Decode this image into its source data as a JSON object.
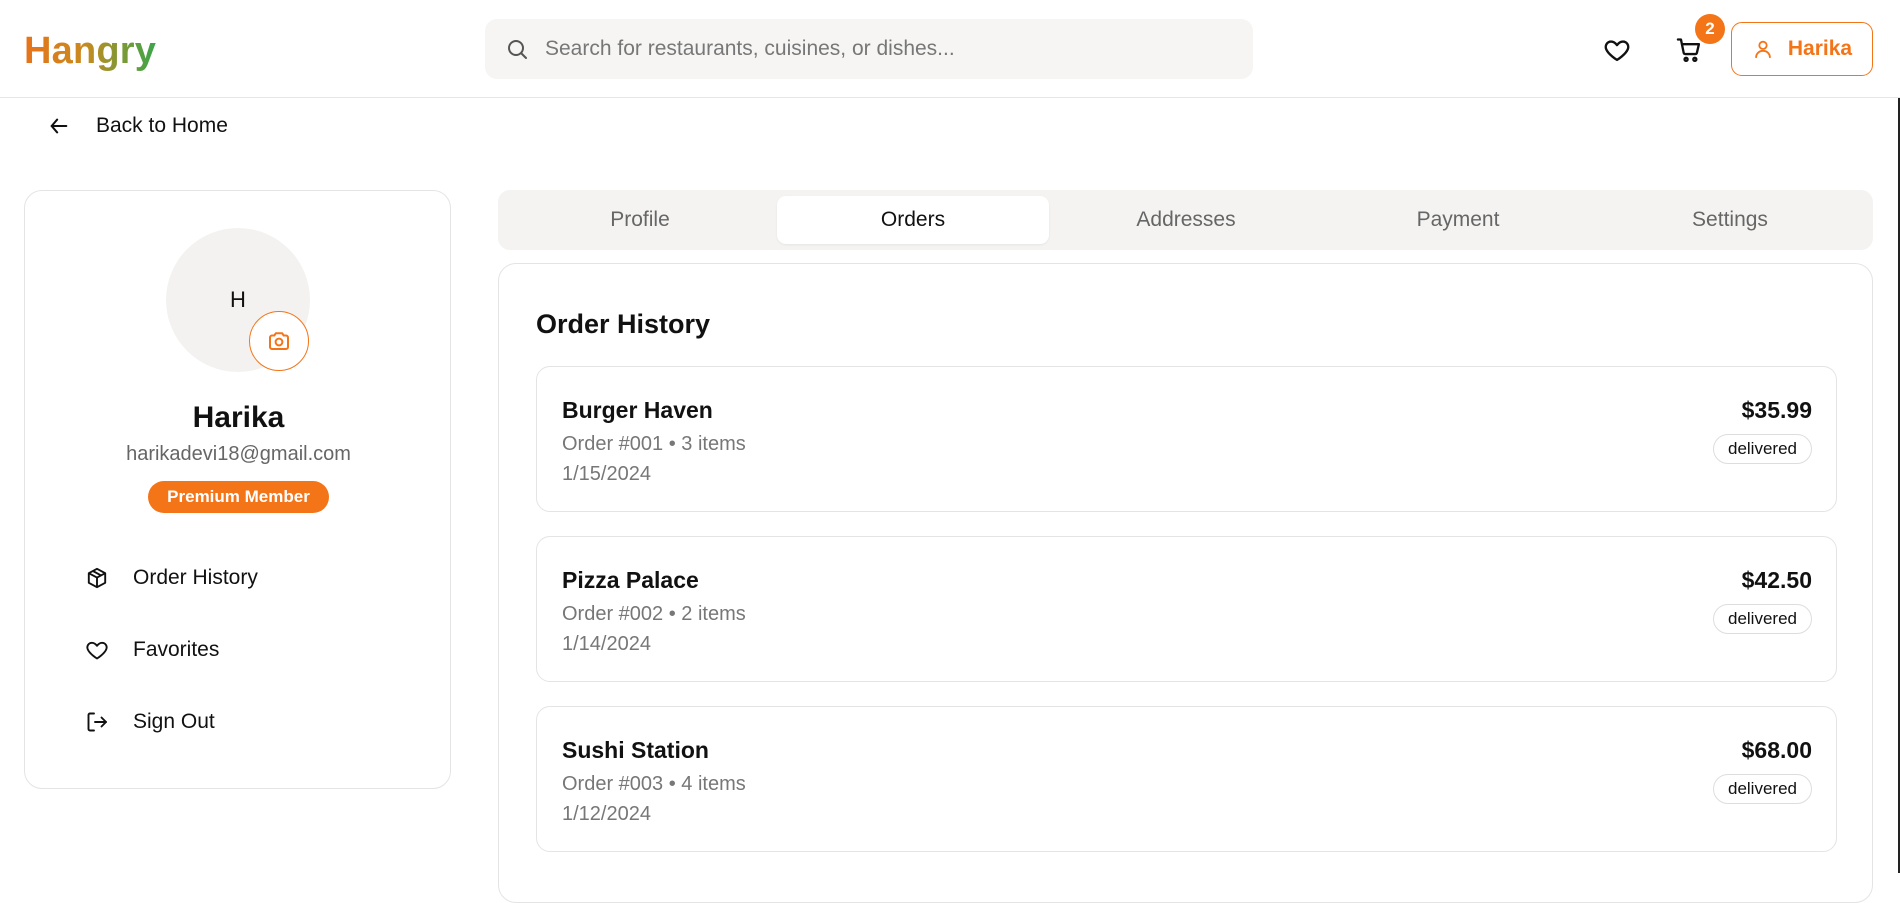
{
  "header": {
    "logo": "Hangry",
    "search_placeholder": "Search for restaurants, cuisines, or dishes...",
    "cart_count": "2",
    "user_label": "Harika"
  },
  "back_link": "Back to Home",
  "profile": {
    "avatar_initial": "H",
    "name": "Harika",
    "email": "harikadevi18@gmail.com",
    "badge": "Premium Member",
    "menu": [
      {
        "label": "Order History",
        "icon": "package-icon"
      },
      {
        "label": "Favorites",
        "icon": "heart-icon"
      },
      {
        "label": "Sign Out",
        "icon": "sign-out-icon"
      }
    ]
  },
  "tabs": [
    {
      "label": "Profile"
    },
    {
      "label": "Orders",
      "active": true
    },
    {
      "label": "Addresses"
    },
    {
      "label": "Payment"
    },
    {
      "label": "Settings"
    }
  ],
  "orders_panel": {
    "title": "Order History",
    "orders": [
      {
        "restaurant": "Burger Haven",
        "meta": "Order #001 • 3 items",
        "date": "1/15/2024",
        "total": "$35.99",
        "status": "delivered"
      },
      {
        "restaurant": "Pizza Palace",
        "meta": "Order #002 • 2 items",
        "date": "1/14/2024",
        "total": "$42.50",
        "status": "delivered"
      },
      {
        "restaurant": "Sushi Station",
        "meta": "Order #003 • 4 items",
        "date": "1/12/2024",
        "total": "$68.00",
        "status": "delivered"
      }
    ]
  },
  "colors": {
    "accent": "#f47418",
    "logo_gradient": [
      "#e8731a",
      "#3aa64a"
    ],
    "tab_bar": "#f4f3f1"
  }
}
